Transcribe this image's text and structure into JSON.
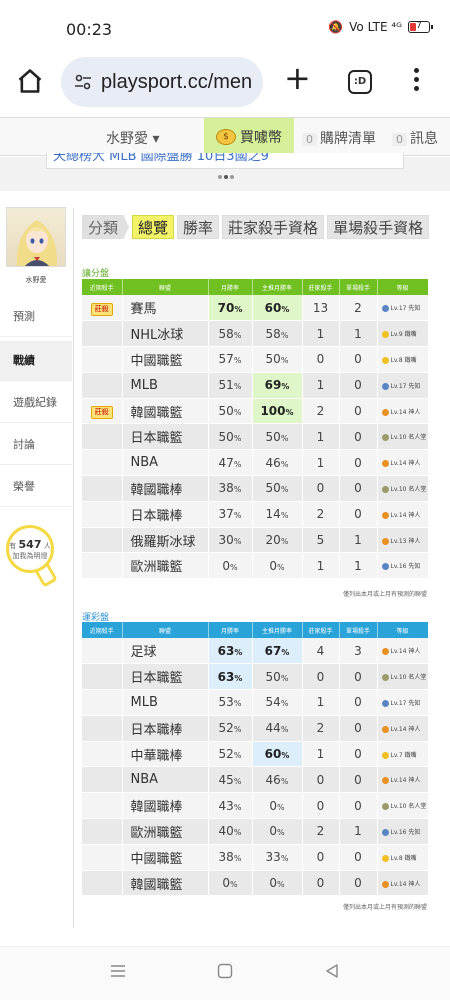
{
  "status": {
    "time": "00:23",
    "signal": "Vo LTE ⁴ᴳ",
    "battery": "7"
  },
  "browser": {
    "url": "playsport.cc/men",
    "tabs_label": ":D"
  },
  "sitebar": {
    "user": "水野愛",
    "coin": "買噱幣",
    "cart_count": "0",
    "cart": "購牌清單",
    "msg_count": "0",
    "msg": "訊息"
  },
  "banner": {
    "text": "天總榜大 MLB 國際盤勝 10日3國之9"
  },
  "sidebar": {
    "name": "水野愛",
    "nav": [
      "預測",
      "戰績",
      "遊戲紀錄",
      "討論",
      "榮譽"
    ],
    "active": "戰績",
    "fans_prefix": "有",
    "fans_count": "547",
    "fans_unit": "人",
    "fans_suffix": "加我為明燈"
  },
  "filter_tabs": [
    "分類",
    "總覽",
    "勝率",
    "莊家殺手資格",
    "單場殺手資格"
  ],
  "headers": [
    "近期殺手",
    "聯盟",
    "月勝率",
    "主推月勝率",
    "莊家殺手",
    "單場殺手",
    "等級"
  ],
  "colors": {
    "green_header": "#6fc020",
    "blue_header": "#29a3d8",
    "green_title": "#5aa820",
    "blue_title": "#2a8fd0"
  },
  "section1": {
    "title": "讓分盤",
    "rows": [
      {
        "badge": "莊殺",
        "league": "賽馬",
        "m": "70",
        "mp": "60",
        "hl_m": true,
        "hl_mp": true,
        "k": "13",
        "s": "2",
        "lvl": "Lv.17 先知",
        "lvc": "#5b84c4"
      },
      {
        "badge": "",
        "league": "NHL冰球",
        "m": "58",
        "mp": "58",
        "k": "1",
        "s": "1",
        "lvl": "Lv.9 鐵嘴",
        "lvc": "#f0c020"
      },
      {
        "badge": "",
        "league": "中國職籃",
        "m": "57",
        "mp": "50",
        "k": "0",
        "s": "0",
        "lvl": "Lv.8 鐵嘴",
        "lvc": "#f0c020"
      },
      {
        "badge": "",
        "league": "MLB",
        "m": "51",
        "mp": "69",
        "hl_mp": true,
        "k": "1",
        "s": "0",
        "lvl": "Lv.17 先知",
        "lvc": "#5b84c4"
      },
      {
        "badge": "莊殺",
        "league": "韓國職籃",
        "m": "50",
        "mp": "100",
        "hl_mp": true,
        "k": "2",
        "s": "0",
        "lvl": "Lv.14 神人",
        "lvc": "#e89020"
      },
      {
        "badge": "",
        "league": "日本職籃",
        "m": "50",
        "mp": "50",
        "k": "1",
        "s": "0",
        "lvl": "Lv.10 名人堂",
        "lvc": "#9a9a6a"
      },
      {
        "badge": "",
        "league": "NBA",
        "m": "47",
        "mp": "46",
        "k": "1",
        "s": "0",
        "lvl": "Lv.14 神人",
        "lvc": "#e89020"
      },
      {
        "badge": "",
        "league": "韓國職棒",
        "m": "38",
        "mp": "50",
        "k": "0",
        "s": "0",
        "lvl": "Lv.10 名人堂",
        "lvc": "#9a9a6a"
      },
      {
        "badge": "",
        "league": "日本職棒",
        "m": "37",
        "mp": "14",
        "k": "2",
        "s": "0",
        "lvl": "Lv.14 神人",
        "lvc": "#e89020"
      },
      {
        "badge": "",
        "league": "俄羅斯冰球",
        "m": "30",
        "mp": "20",
        "k": "5",
        "s": "1",
        "lvl": "Lv.13 神人",
        "lvc": "#e89020"
      },
      {
        "badge": "",
        "league": "歐洲職籃",
        "m": "0",
        "mp": "0",
        "k": "1",
        "s": "1",
        "lvl": "Lv.16 先知",
        "lvc": "#5b84c4"
      }
    ],
    "note": "僅列出本月或上月有預測的聯盟"
  },
  "section2": {
    "title": "運彩盤",
    "rows": [
      {
        "badge": "",
        "league": "足球",
        "m": "63",
        "mp": "67",
        "hl_m": true,
        "hl_mp": true,
        "k": "4",
        "s": "3",
        "lvl": "Lv.14 神人",
        "lvc": "#e89020"
      },
      {
        "badge": "",
        "league": "日本職籃",
        "m": "63",
        "mp": "50",
        "hl_m": true,
        "k": "0",
        "s": "0",
        "lvl": "Lv.10 名人堂",
        "lvc": "#9a9a6a"
      },
      {
        "badge": "",
        "league": "MLB",
        "m": "53",
        "mp": "54",
        "k": "1",
        "s": "0",
        "lvl": "Lv.17 先知",
        "lvc": "#5b84c4"
      },
      {
        "badge": "",
        "league": "日本職棒",
        "m": "52",
        "mp": "44",
        "k": "2",
        "s": "0",
        "lvl": "Lv.14 神人",
        "lvc": "#e89020"
      },
      {
        "badge": "",
        "league": "中華職棒",
        "m": "52",
        "mp": "60",
        "hl_mp": true,
        "k": "1",
        "s": "0",
        "lvl": "Lv.7 鐵嘴",
        "lvc": "#f0c020"
      },
      {
        "badge": "",
        "league": "NBA",
        "m": "45",
        "mp": "46",
        "k": "0",
        "s": "0",
        "lvl": "Lv.14 神人",
        "lvc": "#e89020"
      },
      {
        "badge": "",
        "league": "韓國職棒",
        "m": "43",
        "mp": "0",
        "k": "0",
        "s": "0",
        "lvl": "Lv.10 名人堂",
        "lvc": "#9a9a6a"
      },
      {
        "badge": "",
        "league": "歐洲職籃",
        "m": "40",
        "mp": "0",
        "k": "2",
        "s": "1",
        "lvl": "Lv.16 先知",
        "lvc": "#5b84c4"
      },
      {
        "badge": "",
        "league": "中國職籃",
        "m": "38",
        "mp": "33",
        "k": "0",
        "s": "0",
        "lvl": "Lv.8 鐵嘴",
        "lvc": "#f0c020"
      },
      {
        "badge": "",
        "league": "韓國職籃",
        "m": "0",
        "mp": "0",
        "k": "0",
        "s": "0",
        "lvl": "Lv.14 神人",
        "lvc": "#e89020"
      }
    ],
    "note": "僅列出本月或上月有預測的聯盟"
  }
}
